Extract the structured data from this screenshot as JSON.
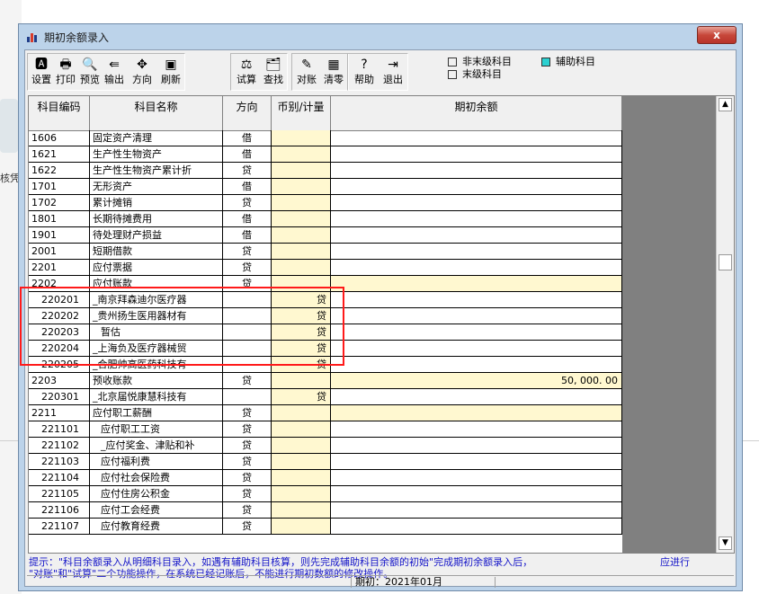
{
  "window": {
    "title": "期初余额录入",
    "close_label": "x"
  },
  "background": {
    "left_text": "核凭"
  },
  "toolbar": [
    {
      "label": "设置",
      "icon": "settings-icon",
      "glyph": "🅰"
    },
    {
      "label": "打印",
      "icon": "printer-icon",
      "glyph": "🖶"
    },
    {
      "label": "预览",
      "icon": "preview-icon",
      "glyph": "🔍"
    },
    {
      "label": "输出",
      "icon": "export-icon",
      "glyph": "⇚"
    },
    {
      "label": "方向",
      "icon": "direction-icon",
      "glyph": "✥"
    },
    {
      "label": "刷新",
      "icon": "refresh-icon",
      "glyph": "▣"
    },
    {
      "label": "试算",
      "icon": "balance-icon",
      "glyph": "⚖"
    },
    {
      "label": "查找",
      "icon": "find-icon",
      "glyph": "🗂"
    },
    {
      "label": "对账",
      "icon": "reconcile-icon",
      "glyph": "✎"
    },
    {
      "label": "清零",
      "icon": "clear-icon",
      "glyph": "▦"
    },
    {
      "label": "帮助",
      "icon": "help-icon",
      "glyph": "?"
    },
    {
      "label": "退出",
      "icon": "exit-icon",
      "glyph": "⇥"
    }
  ],
  "legend": {
    "non_leaf": "非末级科目",
    "auxiliary": "辅助科目",
    "leaf": "末级科目",
    "aux_color": "#2bd0d0"
  },
  "grid": {
    "headers": [
      "科目编码",
      "科目名称",
      "方向",
      "币别/计量",
      "期初余额"
    ],
    "rows": [
      {
        "code": "1606",
        "name": "固定资产清理",
        "dir": "借",
        "cur": "",
        "bal": "",
        "sub": false,
        "ind": false,
        "yl": false
      },
      {
        "code": "1621",
        "name": "生产性生物资产",
        "dir": "借",
        "cur": "",
        "bal": "",
        "sub": false,
        "ind": false,
        "yl": false
      },
      {
        "code": "1622",
        "name": "生产性生物资产累计折",
        "dir": "贷",
        "cur": "",
        "bal": "",
        "sub": false,
        "ind": false,
        "yl": false
      },
      {
        "code": "1701",
        "name": "无形资产",
        "dir": "借",
        "cur": "",
        "bal": "",
        "sub": false,
        "ind": false,
        "yl": false
      },
      {
        "code": "1702",
        "name": "累计摊销",
        "dir": "贷",
        "cur": "",
        "bal": "",
        "sub": false,
        "ind": false,
        "yl": false
      },
      {
        "code": "1801",
        "name": "长期待摊费用",
        "dir": "借",
        "cur": "",
        "bal": "",
        "sub": false,
        "ind": false,
        "yl": false
      },
      {
        "code": "1901",
        "name": "待处理财产损益",
        "dir": "借",
        "cur": "",
        "bal": "",
        "sub": false,
        "ind": false,
        "yl": false
      },
      {
        "code": "2001",
        "name": "短期借款",
        "dir": "贷",
        "cur": "",
        "bal": "",
        "sub": false,
        "ind": false,
        "yl": false
      },
      {
        "code": "2201",
        "name": "应付票据",
        "dir": "贷",
        "cur": "",
        "bal": "",
        "sub": false,
        "ind": false,
        "yl": false
      },
      {
        "code": "2202",
        "name": "应付账款",
        "dir": "贷",
        "cur": "",
        "bal": "",
        "sub": false,
        "ind": false,
        "yl": true
      },
      {
        "code": "220201",
        "name": "_南京拜森迪尔医疗器",
        "dir": "",
        "cur": "贷",
        "bal": "",
        "sub": true,
        "ind": false,
        "yl": false
      },
      {
        "code": "220202",
        "name": "_贵州扬生医用器材有",
        "dir": "",
        "cur": "贷",
        "bal": "",
        "sub": true,
        "ind": false,
        "yl": false
      },
      {
        "code": "220203",
        "name": "暂估",
        "dir": "",
        "cur": "贷",
        "bal": "",
        "sub": true,
        "ind": true,
        "yl": false
      },
      {
        "code": "220204",
        "name": "_上海负及医疗器械贸",
        "dir": "",
        "cur": "贷",
        "bal": "",
        "sub": true,
        "ind": false,
        "yl": false
      },
      {
        "code": "220205",
        "name": "_合肥帅高医药科技有",
        "dir": "",
        "cur": "贷",
        "bal": "",
        "sub": true,
        "ind": false,
        "yl": false
      },
      {
        "code": "2203",
        "name": "预收账款",
        "dir": "贷",
        "cur": "",
        "bal": "50, 000. 00",
        "sub": false,
        "ind": false,
        "yl": true
      },
      {
        "code": "220301",
        "name": "_北京届悦康慧科技有",
        "dir": "",
        "cur": "贷",
        "bal": "",
        "sub": true,
        "ind": false,
        "yl": false
      },
      {
        "code": "2211",
        "name": "应付职工薪酬",
        "dir": "贷",
        "cur": "",
        "bal": "",
        "sub": false,
        "ind": false,
        "yl": true
      },
      {
        "code": "221101",
        "name": "应付职工工资",
        "dir": "贷",
        "cur": "",
        "bal": "",
        "sub": true,
        "ind": true,
        "yl": false
      },
      {
        "code": "221102",
        "name": "_应付奖金、津贴和补",
        "dir": "贷",
        "cur": "",
        "bal": "",
        "sub": true,
        "ind": true,
        "yl": false
      },
      {
        "code": "221103",
        "name": "应付福利费",
        "dir": "贷",
        "cur": "",
        "bal": "",
        "sub": true,
        "ind": true,
        "yl": false
      },
      {
        "code": "221104",
        "name": "应付社会保险费",
        "dir": "贷",
        "cur": "",
        "bal": "",
        "sub": true,
        "ind": true,
        "yl": false
      },
      {
        "code": "221105",
        "name": "应付住房公积金",
        "dir": "贷",
        "cur": "",
        "bal": "",
        "sub": true,
        "ind": true,
        "yl": false
      },
      {
        "code": "221106",
        "name": "应付工会经费",
        "dir": "贷",
        "cur": "",
        "bal": "",
        "sub": true,
        "ind": true,
        "yl": false
      },
      {
        "code": "221107",
        "name": "应付教育经费",
        "dir": "贷",
        "cur": "",
        "bal": "",
        "sub": true,
        "ind": true,
        "yl": false
      }
    ]
  },
  "hint": {
    "line1": "提示：\"科目余额录入从明细科目录入，如遇有辅助科目核算，则先完成辅助科目余额的初始\"完成期初余额录入后，",
    "line1_right": "应进行",
    "line2": "\"对账\"和\"试算\"二个功能操作，在系统已经记账后，不能进行期初数额的修改操作。"
  },
  "status": {
    "period": "期初：2021年01月"
  }
}
